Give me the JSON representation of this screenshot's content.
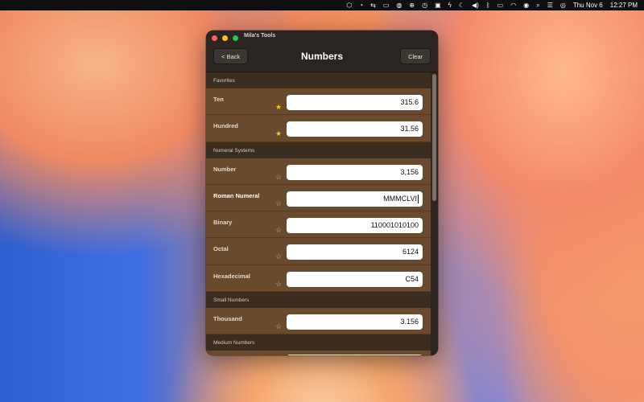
{
  "menubar": {
    "icons": [
      "dropbox-icon",
      "rss-icon",
      "sync-icon",
      "display-icon",
      "globe-icon",
      "network-icon",
      "timer-icon",
      "app-icon",
      "bolt-icon",
      "moon-icon",
      "volume-icon",
      "bluetooth-icon",
      "battery-icon",
      "wifi-icon",
      "user-icon",
      "search-icon",
      "control-center-icon",
      "siri-icon"
    ],
    "date": "Thu Nov 6",
    "time": "12:27 PM"
  },
  "window": {
    "title": "Mila's Tools"
  },
  "navbar": {
    "back_label": "< Back",
    "title": "Numbers",
    "clear_label": "Clear"
  },
  "sections": [
    {
      "header": "Favorites",
      "rows": [
        {
          "label": "Ten",
          "value": "315.6",
          "favorite": true
        },
        {
          "label": "Hundred",
          "value": "31.56",
          "favorite": true
        }
      ]
    },
    {
      "header": "Numeral Systems",
      "rows": [
        {
          "label": "Number",
          "value": "3,156",
          "favorite": false
        },
        {
          "label": "Roman Numeral",
          "value": "MMMCLVI",
          "favorite": false,
          "active": true
        },
        {
          "label": "Binary",
          "value": "110001010100",
          "favorite": false
        },
        {
          "label": "Octal",
          "value": "6124",
          "favorite": false
        },
        {
          "label": "Hexadecimal",
          "value": "C54",
          "favorite": false
        }
      ]
    },
    {
      "header": "Small Numbers",
      "rows": [
        {
          "label": "Thousand",
          "value": "3.156",
          "favorite": false
        }
      ]
    },
    {
      "header": "Medium Numbers",
      "rows": []
    }
  ],
  "colors": {
    "star_on": "#f6c514",
    "row_bg": "#6a4a2c",
    "window_bg": "#2a2521"
  }
}
